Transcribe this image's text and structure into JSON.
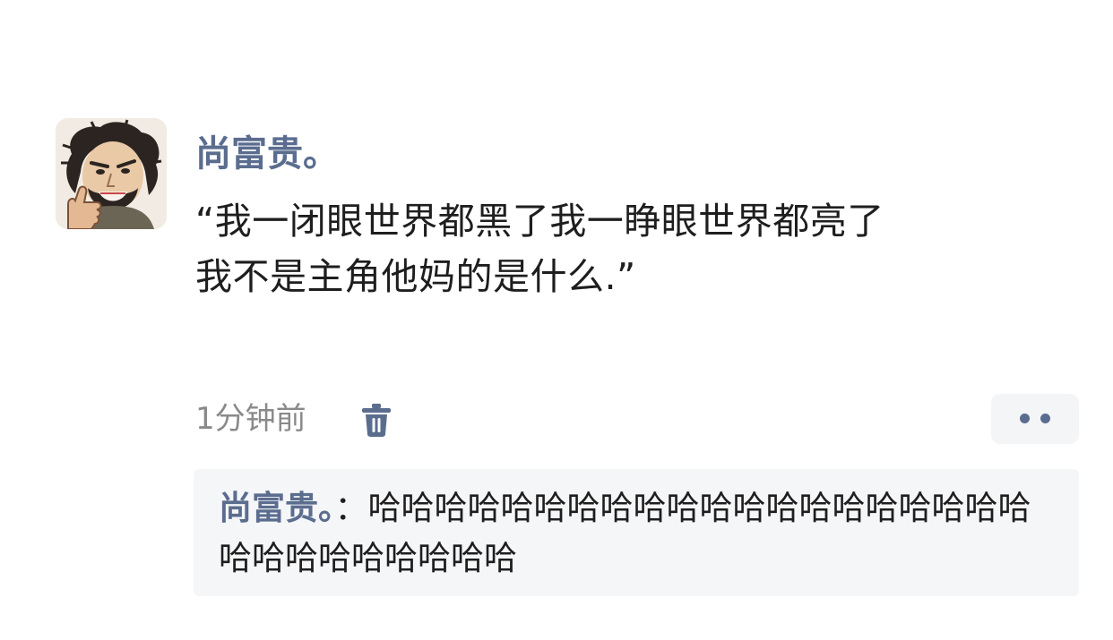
{
  "post": {
    "username": "尚富贵。",
    "text": "“我一闭眼世界都黑了我一睁眼世界都亮了\n我不是主角他妈的是什么.”",
    "time": "1分钟前",
    "delete_icon": "trash-icon",
    "more_icon": "more-dots-icon"
  },
  "reply": {
    "username": "尚富贵。",
    "separator": "：",
    "text": "哈哈哈哈哈哈哈哈哈哈哈哈哈哈哈哈哈哈哈哈哈哈哈哈哈哈哈哈哈"
  },
  "colors": {
    "username": "#5b6d8f",
    "text": "#1e1e1e",
    "meta": "#8a8a8a",
    "reply_bg": "#f5f6f8"
  }
}
